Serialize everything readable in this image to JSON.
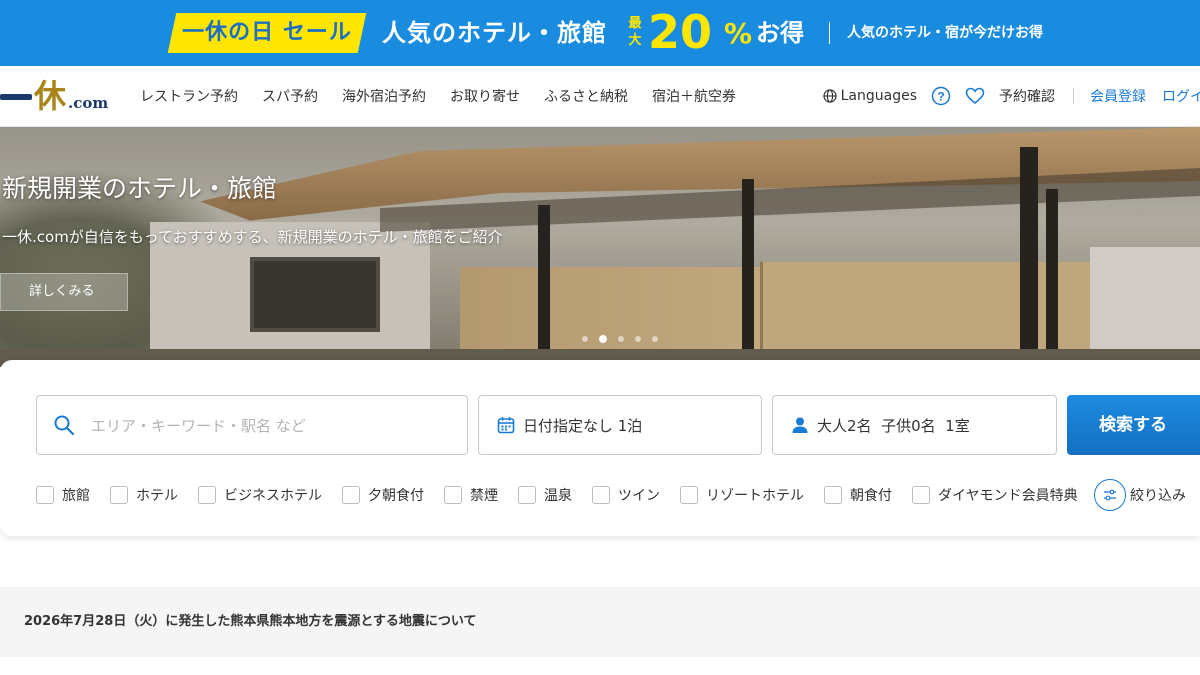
{
  "promo": {
    "tag": "一休の日 セール",
    "headline": "人気のホテル・旅館",
    "max_label": "最大",
    "discount_number": "20",
    "discount_symbol": "%",
    "discount_suffix": "お得",
    "sub": "人気のホテル・宿が今だけお得",
    "colors": {
      "background": "#1a8ce0",
      "tag": "#ffe600",
      "accent": "#ffe600"
    }
  },
  "header": {
    "logo": {
      "dash": "一",
      "kanji": "休",
      "suffix": ".com"
    },
    "nav": [
      {
        "label": "レストラン予約"
      },
      {
        "label": "スパ予約"
      },
      {
        "label": "海外宿泊予約"
      },
      {
        "label": "お取り寄せ"
      },
      {
        "label": "ふるさと納税"
      },
      {
        "label": "宿泊＋航空券"
      }
    ],
    "languages_label": "Languages",
    "reservation_check": "予約確認",
    "member_register": "会員登録",
    "login": "ログイン"
  },
  "hero": {
    "title": "新規開業のホテル・旅館",
    "description": "一休.comが自信をもっておすすめする、新規開業のホテル・旅館をご紹介",
    "button": "詳しくみる",
    "slides": 5,
    "active_slide": 2
  },
  "search": {
    "keyword_placeholder": "エリア・キーワード・駅名 など",
    "date_value": "日付指定なし 1泊",
    "guests_value": "大人2名  子供0名  1室",
    "submit_label": "検索する",
    "filters": [
      {
        "label": "旅館",
        "checked": false
      },
      {
        "label": "ホテル",
        "checked": false
      },
      {
        "label": "ビジネスホテル",
        "checked": false
      },
      {
        "label": "夕朝食付",
        "checked": false
      },
      {
        "label": "禁煙",
        "checked": false
      },
      {
        "label": "温泉",
        "checked": false
      },
      {
        "label": "ツイン",
        "checked": false
      },
      {
        "label": "リゾートホテル",
        "checked": false
      },
      {
        "label": "朝食付",
        "checked": false
      },
      {
        "label": "ダイヤモンド会員特典",
        "checked": false
      }
    ],
    "narrow_label": "絞り込み",
    "accent_color": "#1a7bd6"
  },
  "notice": {
    "text": "2026年7月28日（火）に発生した熊本県熊本地方を震源とする地震について"
  }
}
